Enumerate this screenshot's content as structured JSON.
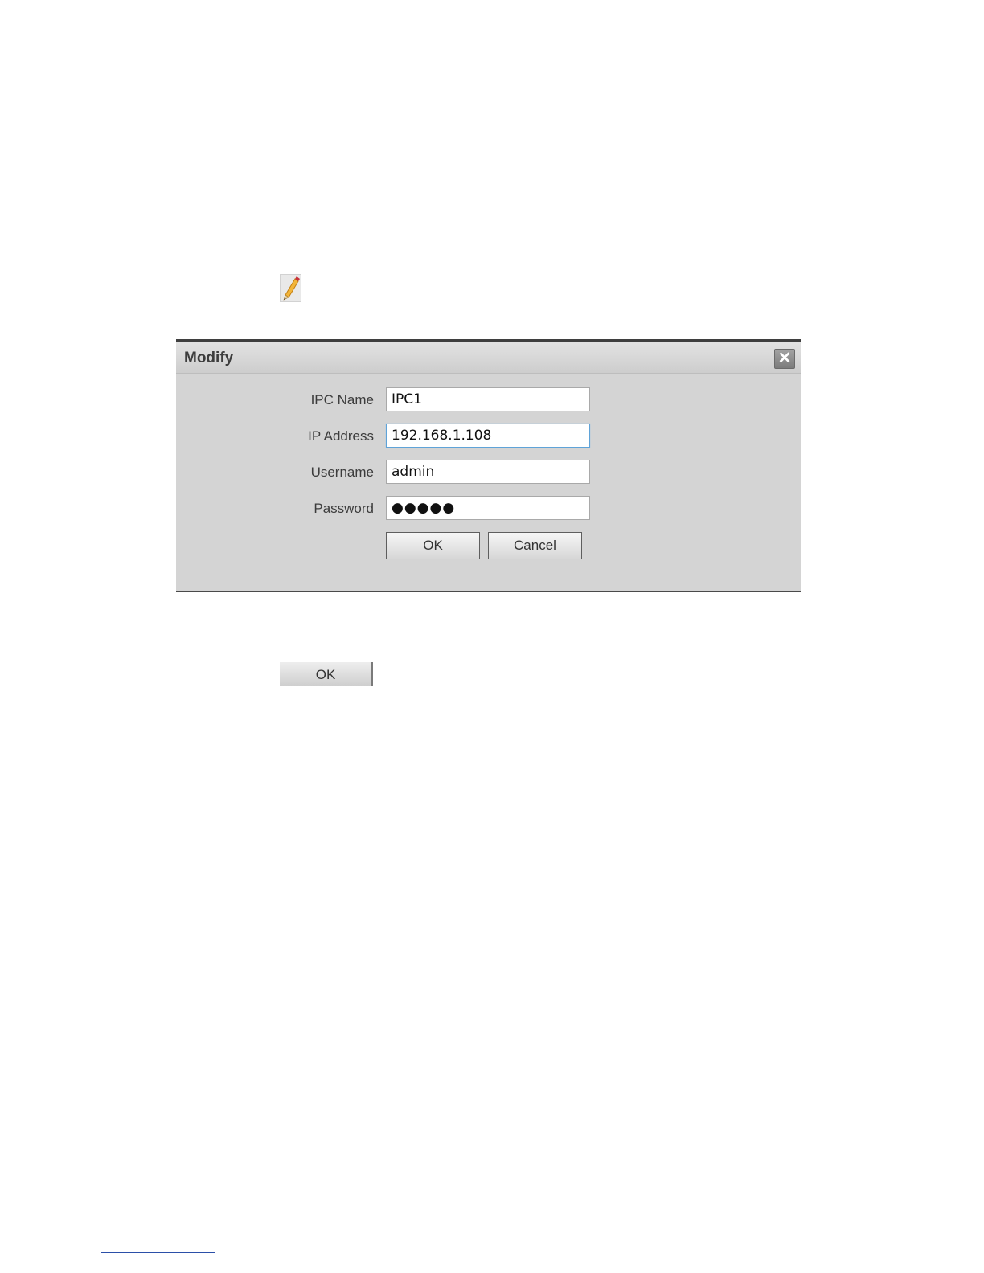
{
  "icons": {
    "edit": "pencil-icon",
    "close": "close-icon"
  },
  "dialog": {
    "title": "Modify",
    "close_glyph": "✕",
    "fields": {
      "ipc_name": {
        "label": "IPC Name",
        "value": "IPC1"
      },
      "ip_address": {
        "label": "IP Address",
        "value": "192.168.1.108"
      },
      "username": {
        "label": "Username",
        "value": "admin"
      },
      "password": {
        "label": "Password",
        "value": "●●●●●"
      }
    },
    "ok_label": "OK",
    "cancel_label": "Cancel"
  },
  "standalone": {
    "ok_label": "OK"
  },
  "colors": {
    "dialog_bg": "#d4d4d4",
    "focus_border": "#5fa3d8",
    "footnote_rule": "#2b4fa8"
  }
}
